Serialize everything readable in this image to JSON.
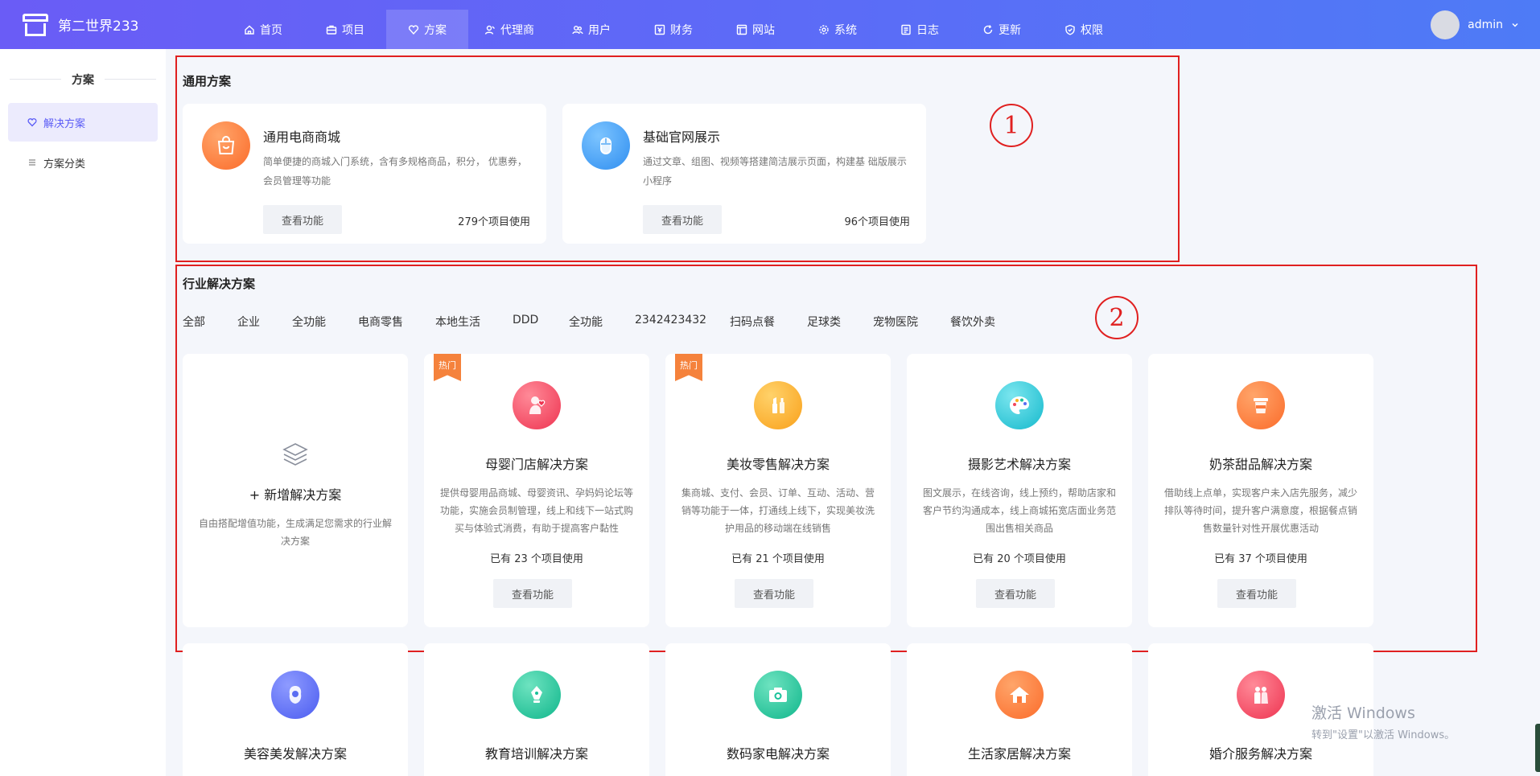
{
  "header": {
    "brand": "第二世界233",
    "nav": [
      {
        "label": "首页",
        "icon": "home-icon"
      },
      {
        "label": "项目",
        "icon": "briefcase-icon"
      },
      {
        "label": "方案",
        "icon": "heart-icon"
      },
      {
        "label": "代理商",
        "icon": "agent-icon"
      },
      {
        "label": "用户",
        "icon": "users-icon"
      },
      {
        "label": "财务",
        "icon": "finance-icon"
      },
      {
        "label": "网站",
        "icon": "website-icon"
      },
      {
        "label": "系统",
        "icon": "gear-icon"
      },
      {
        "label": "日志",
        "icon": "log-icon"
      },
      {
        "label": "更新",
        "icon": "refresh-icon"
      },
      {
        "label": "权限",
        "icon": "shield-check-icon"
      }
    ],
    "active_nav": "方案",
    "user": "admin"
  },
  "sidebar": {
    "title": "方案",
    "items": [
      {
        "label": "解决方案",
        "icon": "heart-icon",
        "active": true
      },
      {
        "label": "方案分类",
        "icon": "list-icon",
        "active": false
      }
    ]
  },
  "general": {
    "title": "通用方案",
    "cards": [
      {
        "title": "通用电商商城",
        "desc": "简单便捷的商城入门系统，含有多规格商品，积分， 优惠券，会员管理等功能",
        "button": "查看功能",
        "count": "279个项目使用",
        "icon": "shopping-bag-icon",
        "color": "#fb7a3c"
      },
      {
        "title": "基础官网展示",
        "desc": "通过文章、组图、视频等搭建简洁展示页面，构建基 础版展示小程序",
        "button": "查看功能",
        "count": "96个项目使用",
        "icon": "mouse-icon",
        "color": "#3d9df4"
      }
    ],
    "marker": "1"
  },
  "industry": {
    "title": "行业解决方案",
    "marker": "2",
    "tabs": [
      "全部",
      "企业",
      "全功能",
      "电商零售",
      "本地生活",
      "DDD",
      "全功能",
      "2342423432",
      "扫码点餐",
      "足球类",
      "宠物医院",
      "餐饮外卖"
    ],
    "new_card": {
      "title": "+ 新增解决方案",
      "desc": "自由搭配增值功能，生成满足您需求的行业解决方案",
      "icon": "layers-icon"
    },
    "cards": [
      {
        "title": "母婴门店解决方案",
        "desc": "提供母婴用品商城、母婴资讯、孕妈妈论坛等功能，实施会员制管理，线上和线下一站式购买与体验式消费，有助于提高客户黏性",
        "count": "已有 23 个项目使用",
        "button": "查看功能",
        "hot": "热门",
        "icon": "baby-icon",
        "color": "#f2455a"
      },
      {
        "title": "美妆零售解决方案",
        "desc": "集商城、支付、会员、订单、互动、活动、营销等功能于一体，打通线上线下，实现美妆洗护用品的移动端在线销售",
        "count": "已有 21 个项目使用",
        "button": "查看功能",
        "hot": "热门",
        "icon": "cosmetics-icon",
        "color": "#fbb21c"
      },
      {
        "title": "摄影艺术解决方案",
        "desc": "图文展示，在线咨询，线上预约，帮助店家和客户节约沟通成本，线上商城拓宽店面业务范围出售相关商品",
        "count": "已有 20 个项目使用",
        "button": "查看功能",
        "hot": "",
        "icon": "palette-icon",
        "color": "#27c7d8"
      },
      {
        "title": "奶茶甜品解决方案",
        "desc": "借助线上点单，实现客户未入店先服务，减少排队等待时间，提升客户满意度，根据餐点销售数量针对性开展优惠活动",
        "count": "已有 37 个项目使用",
        "button": "查看功能",
        "hot": "",
        "icon": "cup-icon",
        "color": "#fb7a3c"
      }
    ],
    "row2": [
      {
        "title": "美容美发解决方案",
        "icon": "beauty-icon",
        "color": "#5a6cf2"
      },
      {
        "title": "教育培训解决方案",
        "icon": "pen-nib-icon",
        "color": "#19c19a"
      },
      {
        "title": "数码家电解决方案",
        "icon": "camera-icon",
        "color": "#19c19a"
      },
      {
        "title": "生活家居解决方案",
        "icon": "house-icon",
        "color": "#fb7a3c"
      },
      {
        "title": "婚介服务解决方案",
        "icon": "couple-icon",
        "color": "#f2455a"
      }
    ]
  },
  "watermark": {
    "line1": "激活 Windows",
    "line2": "转到\"设置\"以激活 Windows。"
  }
}
